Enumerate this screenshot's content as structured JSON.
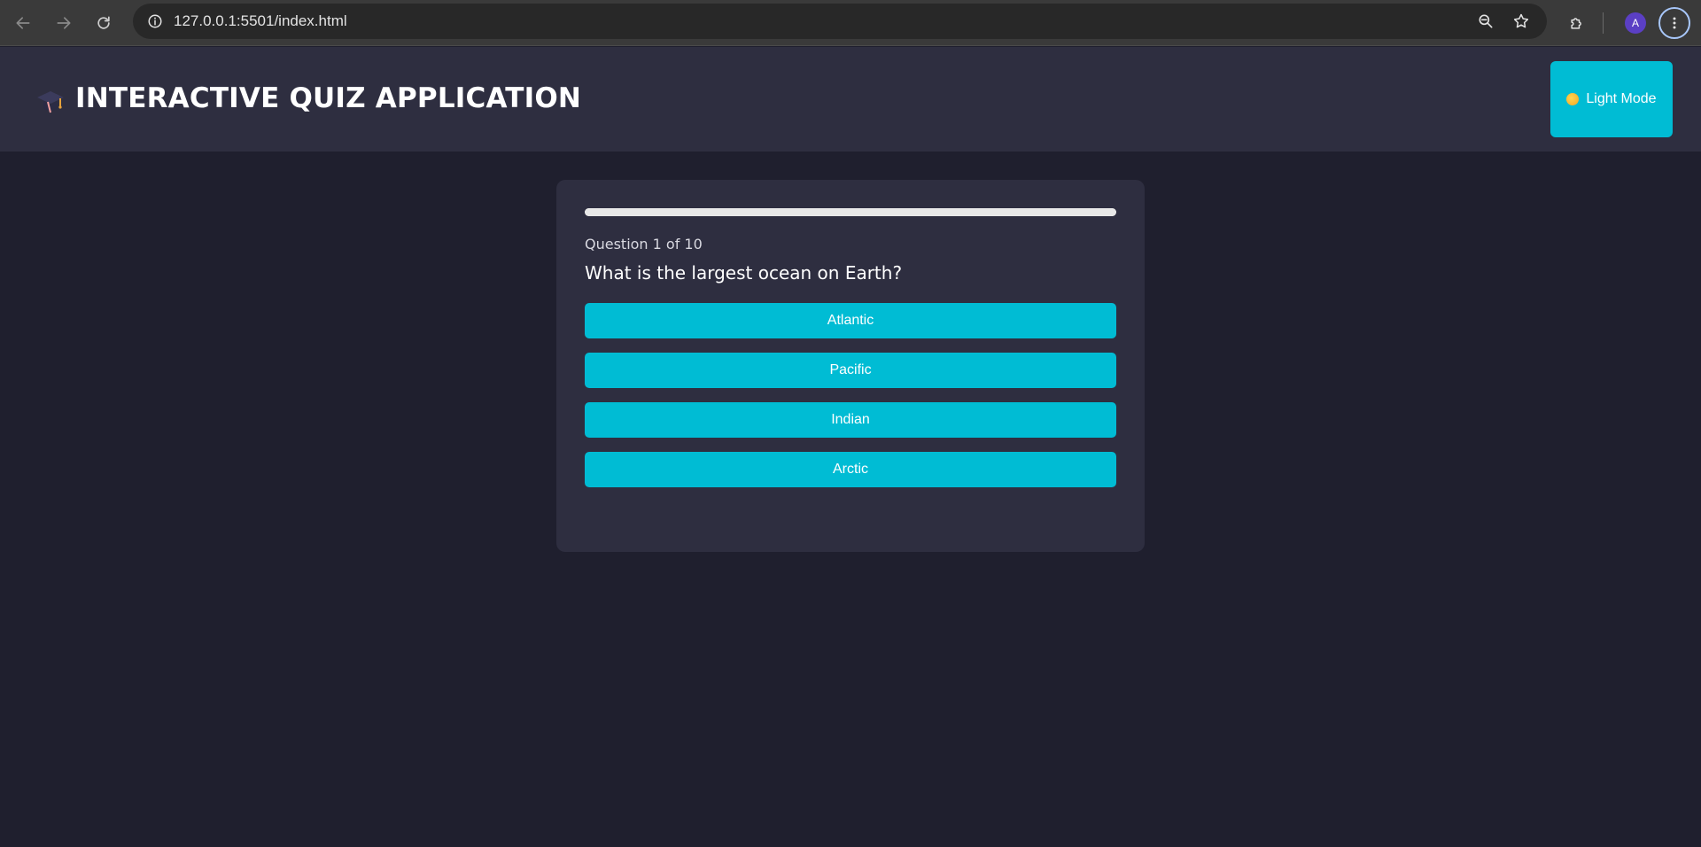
{
  "browser": {
    "url": "127.0.0.1:5501/index.html",
    "profile_initial": "A"
  },
  "header": {
    "title": "INTERACTIVE QUIZ APPLICATION",
    "logo_icon": "graduation-cap-icon",
    "theme_toggle": {
      "label": "Light Mode",
      "icon": "sun-icon"
    }
  },
  "quiz": {
    "progress": 1.0,
    "counter": "Question 1 of 10",
    "question": "What is the largest ocean on Earth?",
    "options": [
      {
        "label": "Atlantic"
      },
      {
        "label": "Pacific"
      },
      {
        "label": "Indian"
      },
      {
        "label": "Arctic"
      }
    ]
  },
  "colors": {
    "page_bg": "#1f1f2e",
    "header_bg": "#2e2e40",
    "card_bg": "#2e2e40",
    "accent": "#00bcd4",
    "progress": "#e8e8e8"
  }
}
